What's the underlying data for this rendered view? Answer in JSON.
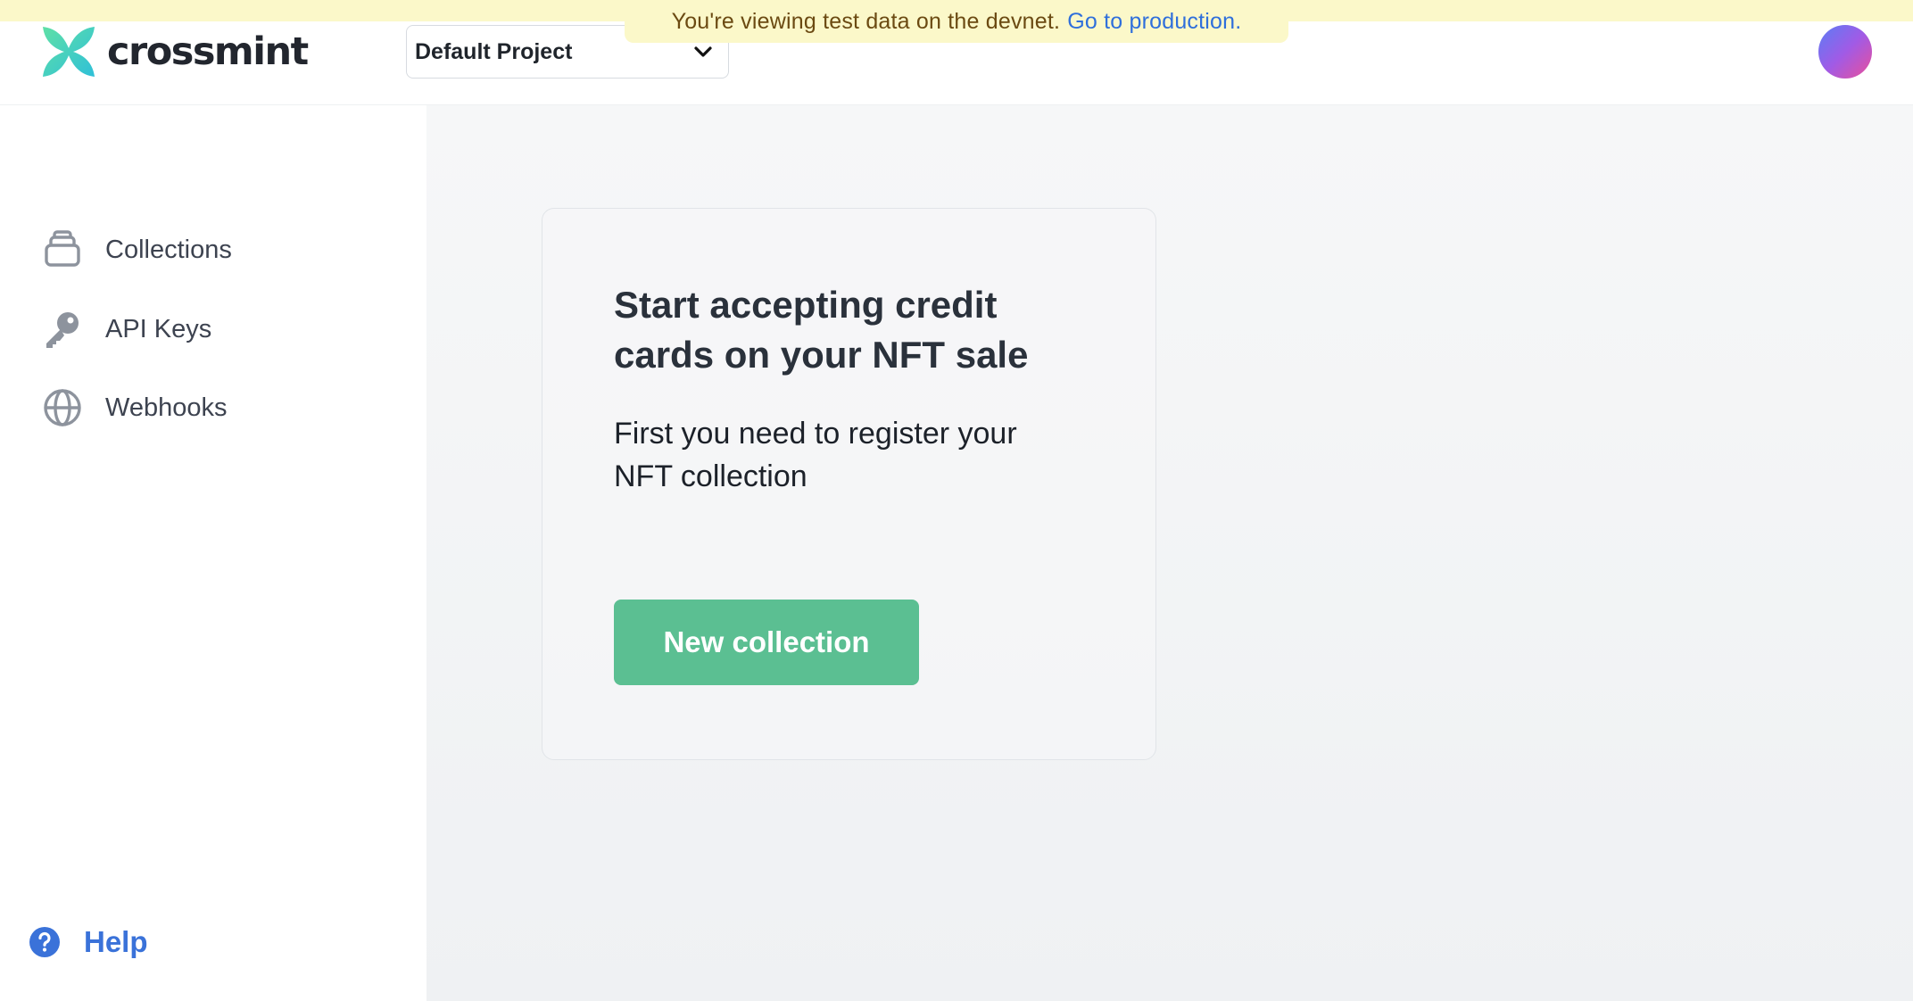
{
  "banner": {
    "message": "You're viewing test data on the devnet.",
    "link_label": "Go to production."
  },
  "header": {
    "brand_name": "crossmint",
    "logo_icon": "crossmint-x-logo-icon",
    "project_selector": {
      "selected": "Default Project",
      "icon": "chevron-down-icon"
    },
    "avatar_icon": "user-avatar"
  },
  "sidebar": {
    "items": [
      {
        "label": "Collections",
        "icon": "collections-stack-icon"
      },
      {
        "label": "API Keys",
        "icon": "key-icon"
      },
      {
        "label": "Webhooks",
        "icon": "globe-icon"
      }
    ],
    "help": {
      "label": "Help",
      "icon": "question-circle-icon"
    }
  },
  "main": {
    "card": {
      "title": "Start accepting credit cards on your NFT sale",
      "description": "First you need to register your NFT collection",
      "button_label": "New collection"
    }
  },
  "colors": {
    "banner_bg": "#fbf8c9",
    "link": "#2f6fdb",
    "primary_button": "#5bbf92",
    "help": "#3a72d9",
    "main_bg": "#f3f5f6"
  }
}
